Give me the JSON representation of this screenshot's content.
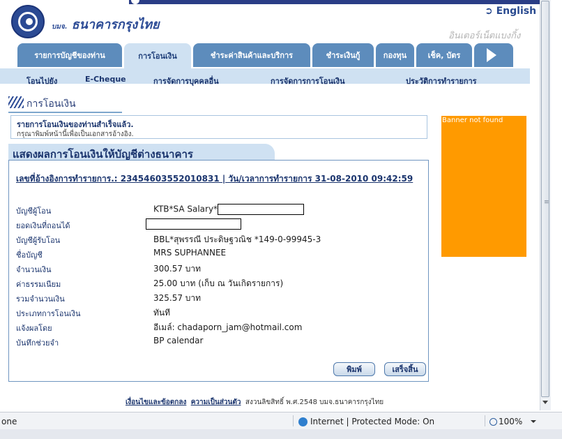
{
  "header": {
    "bank_prefix": "บมจ.",
    "bank_name": "ธนาคารกรุงไทย",
    "english_link": "English",
    "tagline": "อินเตอร์เน็ตแบงกิ้ง"
  },
  "tabs": [
    {
      "label": "รายการบัญชีของท่าน"
    },
    {
      "label": "การโอนเงิน"
    },
    {
      "label": "ชำระค่าสินค้าและบริการ"
    },
    {
      "label": "ชำระเงินกู้"
    },
    {
      "label": "กองทุน"
    },
    {
      "label": "เช็ค, บัตร"
    }
  ],
  "subnav": [
    {
      "label": "โอนไปยัง"
    },
    {
      "label": "E-Cheque"
    },
    {
      "label": "การจัดการบุคคลอื่น"
    },
    {
      "label": "การจัดการการโอนเงิน"
    },
    {
      "label": "ประวัติการทำรายการ"
    }
  ],
  "page": {
    "title": "การโอนเงิน",
    "success_main": "รายการโอนเงินของท่านสำเร็จแล้ว.",
    "success_sub": "กรุณาพิมพ์หน้านี้เพื่อเป็นเอกสารอ้างอิง.",
    "section_title": "แสดงผลการโอนเงินให้บัญชีต่างธนาคาร",
    "reference_line": "เลขที่อ้างอิงการทำรายการ.: 23454603552010831 | วัน/เวลาการทำรายการ 31-08-2010 09:42:59"
  },
  "details": [
    {
      "label": "บัญชีผู้โอน",
      "value": "KTB*SA Salary*"
    },
    {
      "label": "ยอดเงินที่ถอนได้",
      "value": ""
    },
    {
      "label": "บัญชีผู้รับโอน",
      "value": "BBL*สุพรรณี ประดิษฐวณิช *149-0-99945-3"
    },
    {
      "label": "ชื่อบัญชี",
      "value": "MRS SUPHANNEE"
    },
    {
      "label": "จำนวนเงิน",
      "value": "300.57 บาท"
    },
    {
      "label": "ค่าธรรมเนียม",
      "value": "25.00 บาท  (เก็บ ณ วันเกิดรายการ)"
    },
    {
      "label": "รวมจำนวนเงิน",
      "value": "325.57 บาท"
    },
    {
      "label": "ประเภทการโอนเงิน",
      "value": "ทันที"
    },
    {
      "label": "แจ้งผลโดย",
      "value": "อีเมล์: chadaporn_jam@hotmail.com"
    },
    {
      "label": "บันทึกช่วยจำ",
      "value": "BP calendar"
    }
  ],
  "buttons": {
    "print": "พิมพ์",
    "finish": "เสร็จสิ้น"
  },
  "banner": {
    "text": "Banner not found",
    "color": "#ff9a00"
  },
  "footer": {
    "terms": "เงื่อนไขและข้อตกลง",
    "privacy": "ความเป็นส่วนตัว",
    "copyright": "สงวนลิขสิทธิ์ พ.ศ.2548 บมจ.ธนาคารกรุงไทย"
  },
  "statusbar": {
    "left": "one",
    "zone": "Internet | Protected Mode: On",
    "zoom": "100%"
  }
}
